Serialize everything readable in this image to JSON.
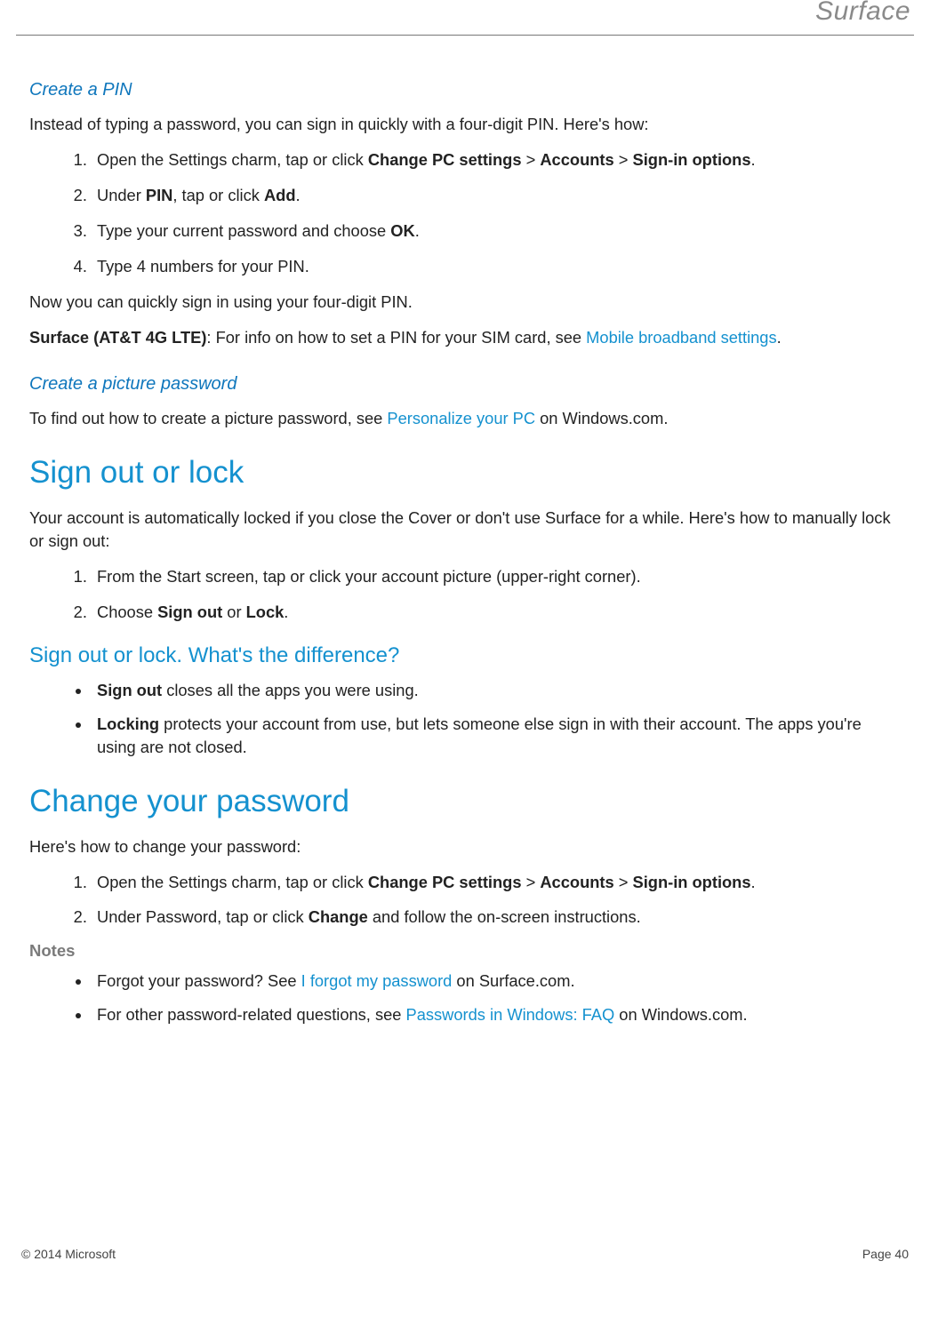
{
  "brand": "Surface",
  "sectionPin": {
    "heading": "Create a PIN",
    "intro": "Instead of typing a password, you can sign in quickly with a four-digit PIN. Here's how:",
    "afterList": "Now you can quickly sign in using your four-digit PIN.",
    "surfaceLTE_label": "Surface (AT&T 4G LTE)",
    "surfaceLTE_text_afterLabel": ": For info on how to set a PIN for your SIM card, see ",
    "surfaceLTE_link": "Mobile broadband settings",
    "period": ".",
    "steps": {
      "s1a": "Open the Settings charm, tap or click ",
      "s1_b1": "Change PC settings",
      "gt": " > ",
      "s1_b2": "Accounts",
      "s1_b3": "Sign-in options",
      "s2a": "Under ",
      "s2_b1": "PIN",
      "s2b": ", tap or click ",
      "s2_b2": "Add",
      "s3a": "Type your current password and choose ",
      "s3_b1": "OK",
      "s4": "Type 4 numbers for your PIN."
    }
  },
  "sectionPicture": {
    "heading": "Create a picture password",
    "text_a": "To find out how to create a picture password, see ",
    "link": "Personalize your PC",
    "text_b": " on Windows.com."
  },
  "sectionSignOut": {
    "heading": "Sign out or lock",
    "intro": "Your account is automatically locked if you close the Cover or don't use Surface for a while. Here's how to manually lock or sign out:",
    "steps": {
      "s1": "From the Start screen, tap or click your account picture (upper-right corner).",
      "s2a": "Choose ",
      "s2_b1": "Sign out",
      "s2b": " or ",
      "s2_b2": "Lock"
    },
    "subheading": "Sign out or lock. What's the difference?",
    "bul": {
      "b1_b": "Sign out",
      "b1_t": " closes all the apps you were using.",
      "b2_b": "Locking",
      "b2_t": " protects your account from use, but lets someone else sign in with their account. The apps you're using are not closed."
    }
  },
  "sectionChange": {
    "heading": "Change your password",
    "intro": "Here's how to change your password:",
    "steps": {
      "s1a": "Open the Settings charm, tap or click ",
      "s1_b1": "Change PC settings",
      "gt": " > ",
      "s1_b2": "Accounts",
      "s1_b3": "Sign-in options",
      "s2a": "Under Password, tap or click ",
      "s2_b1": "Change",
      "s2b": " and follow the on-screen instructions."
    },
    "notesLabel": "Notes",
    "notes": {
      "n1a": "Forgot your password? See ",
      "n1_link": "I forgot my password",
      "n1b": " on Surface.com.",
      "n2a": "For other password-related questions, see ",
      "n2_link": "Passwords in Windows: FAQ",
      "n2b": " on Windows.com."
    }
  },
  "footer": {
    "left": "© 2014 Microsoft",
    "right": "Page 40"
  }
}
